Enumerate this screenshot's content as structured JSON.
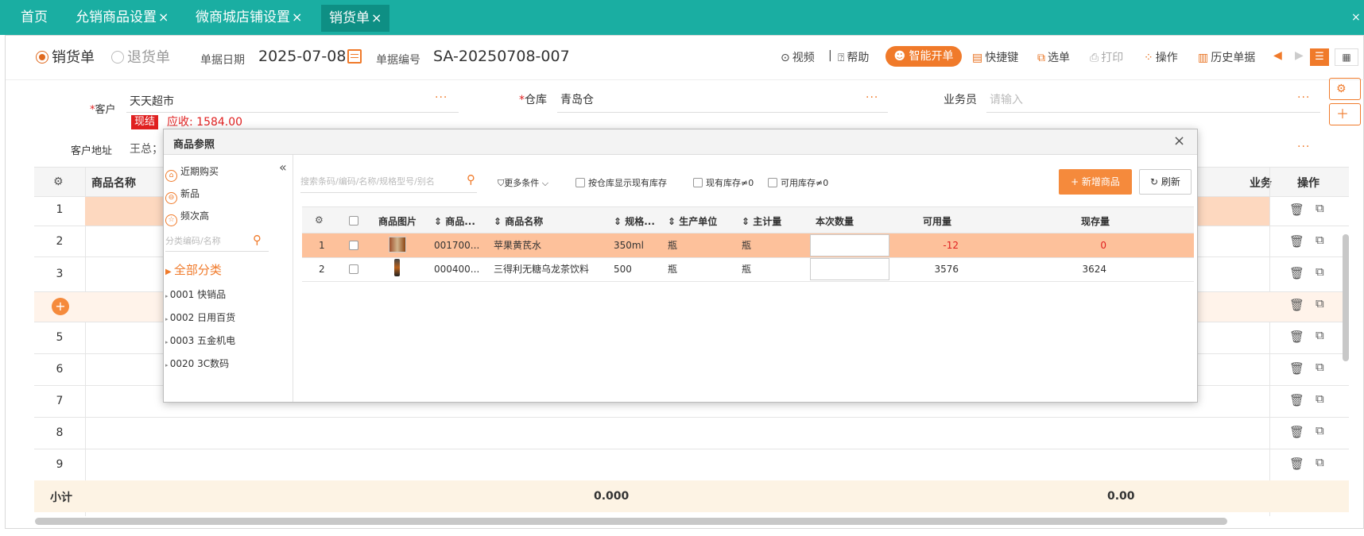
{
  "tabs": [
    {
      "label": "首页",
      "closable": false
    },
    {
      "label": "允销商品设置",
      "closable": true
    },
    {
      "label": "微商城店铺设置",
      "closable": true
    },
    {
      "label": "销货单",
      "closable": true,
      "active": true
    }
  ],
  "tab_close": "×",
  "toolbar": {
    "radio_sales": "销货单",
    "radio_return": "退货单",
    "date_label": "单据日期",
    "date_value": "2025-07-08",
    "no_label": "单据编号",
    "no_value": "SA-20250708-007",
    "video": "视频",
    "sep": "|",
    "help": "帮助",
    "ai": "智能开单",
    "shortcut": "快捷键",
    "select": "选单",
    "print": "打印",
    "ops": "操作",
    "history": "历史单据"
  },
  "form": {
    "customer_label": "客户",
    "customer_value": "天天超市",
    "cash_badge": "现结",
    "receivable": "应收: 1584.00",
    "warehouse_label": "仓库",
    "warehouse_value": "青岛仓",
    "salesman_label": "业务员",
    "salesman_placeholder": "请输入",
    "address_label": "客户地址",
    "address_value": "王总；",
    "more": "···"
  },
  "grid": {
    "col_name": "商品名称",
    "col_ops": "操作",
    "col_biz": "业务",
    "row_labels": [
      "1",
      "2",
      "3",
      "+",
      "5",
      "6",
      "7",
      "8",
      "9"
    ],
    "subtotal_label": "小计",
    "subtotal_qty": "0.000",
    "subtotal_amount": "0.00"
  },
  "modal": {
    "title": "商品参照",
    "close": "×",
    "side": {
      "recent": "近期购买",
      "new": "新品",
      "frequent": "频次高",
      "collapse": "«",
      "cat_search_placeholder": "分类编码/名称",
      "all": "全部分类",
      "categories": [
        "0001 快销品",
        "0002 日用百货",
        "0003 五金机电",
        "0020 3C数码"
      ]
    },
    "search_placeholder": "搜索条码/编码/名称/规格型号/别名",
    "more_filters": "更多条件",
    "filter1": "按仓库显示现有库存",
    "filter2": "现有库存≠0",
    "filter3": "可用库存≠0",
    "new_btn": "+ 新增商品",
    "refresh_btn": "刷新",
    "columns": [
      "商品图片",
      "商品...",
      "商品名称",
      "规格...",
      "生产单位",
      "主计量",
      "本次数量",
      "可用量",
      "现存量"
    ],
    "rows": [
      {
        "no": "1",
        "code": "001700...",
        "name": "苹果黄芪水",
        "spec": "350ml",
        "unit": "瓶",
        "main_unit": "瓶",
        "available": "-12",
        "stock": "0",
        "highlight": true
      },
      {
        "no": "2",
        "code": "000400...",
        "name": "三得利无糖乌龙茶饮料",
        "spec": "500",
        "unit": "瓶",
        "main_unit": "瓶",
        "available": "3576",
        "stock": "3624",
        "highlight": false
      }
    ]
  },
  "colors": {
    "teal": "#1aaea2",
    "orange": "#f07a2a",
    "highlight_row": "#fdc19b",
    "red": "#e02020"
  }
}
